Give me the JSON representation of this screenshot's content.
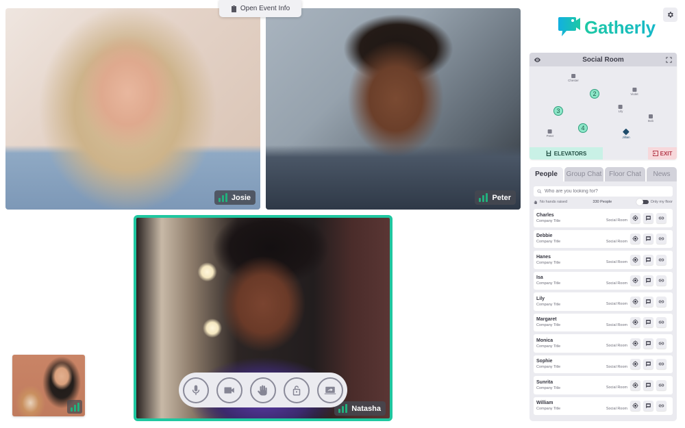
{
  "event_info_button": {
    "label": "Open Event Info",
    "icon": "clipboard-icon"
  },
  "brand": {
    "name": "Gatherly",
    "logo_icon": "video-chat-bubble-icon",
    "accent_color": "#1dc8a4"
  },
  "settings_button": {
    "icon": "gear-icon"
  },
  "videos": [
    {
      "name": "Josie",
      "signal_bars": 3
    },
    {
      "name": "Peter",
      "signal_bars": 3
    },
    {
      "name": "Natasha",
      "signal_bars": 3,
      "active_speaker": true,
      "highlight_color": "#1fc7a0"
    },
    {
      "name": "",
      "self_view": true,
      "signal_bars": 3
    }
  ],
  "controls": [
    {
      "name": "microphone",
      "icon": "microphone-icon"
    },
    {
      "name": "camera",
      "icon": "camera-icon"
    },
    {
      "name": "raise-hand",
      "icon": "hand-icon"
    },
    {
      "name": "lock",
      "icon": "unlock-icon"
    },
    {
      "name": "share-screen",
      "icon": "share-screen-icon"
    }
  ],
  "room": {
    "title": "Social Room",
    "view_icon": "eye-icon",
    "expand_icon": "fullscreen-icon",
    "people": [
      {
        "name": "Chester"
      },
      {
        "name": "Violet"
      },
      {
        "name": "Lily"
      },
      {
        "name": "Bob"
      },
      {
        "name": "Peter"
      },
      {
        "name": "Jillian",
        "is_me": true
      }
    ],
    "tables": [
      "2",
      "3",
      "4"
    ],
    "elevators_label": "ELEVATORS",
    "exit_label": "EXIT"
  },
  "people_panel": {
    "tabs": [
      {
        "label": "People",
        "active": true
      },
      {
        "label": "Group Chat",
        "active": false
      },
      {
        "label": "Floor Chat",
        "active": false
      },
      {
        "label": "News",
        "active": false
      }
    ],
    "search_placeholder": "Who are you looking for?",
    "hands_status": "No hands raised",
    "people_count": "330 People",
    "only_my_floor_label": "Only my floor",
    "list": [
      {
        "name": "Charles",
        "title": "Company Title",
        "room": "Social Room"
      },
      {
        "name": "Debbie",
        "title": "Company Title",
        "room": "Social Room"
      },
      {
        "name": "Hanes",
        "title": "Company Title",
        "room": "Social Room"
      },
      {
        "name": "Isa",
        "title": "Company Title",
        "room": "Social Room"
      },
      {
        "name": "Lily",
        "title": "Company Title",
        "room": "Social Room"
      },
      {
        "name": "Margaret",
        "title": "Company Title",
        "room": "Social Room"
      },
      {
        "name": "Monica",
        "title": "Company Title",
        "room": "Social Room"
      },
      {
        "name": "Sophie",
        "title": "Company Title",
        "room": "Social Room"
      },
      {
        "name": "Sunrita",
        "title": "Company Title",
        "room": "Social Room"
      },
      {
        "name": "William",
        "title": "Company Title",
        "room": "Social Room"
      }
    ]
  }
}
